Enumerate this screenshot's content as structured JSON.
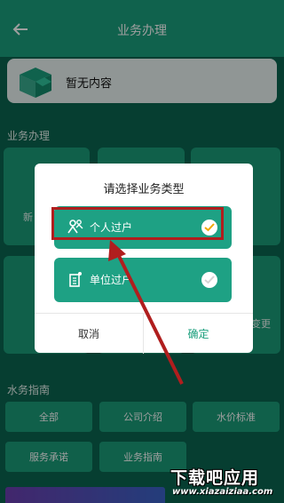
{
  "header": {
    "title": "业务办理"
  },
  "empty_card": {
    "text": "暂无内容"
  },
  "sections": {
    "business": "业务办理",
    "guide": "水务指南"
  },
  "background_tiles": {
    "left_partial": "新",
    "right_partial": "变更"
  },
  "guide_buttons": [
    "全部",
    "公司介绍",
    "水价标准",
    "服务承诺",
    "业务指南"
  ],
  "dialog": {
    "title": "请选择业务类型",
    "options": [
      {
        "label": "个人过户",
        "icon": "user-transfer-icon",
        "selected": true
      },
      {
        "label": "单位过户",
        "icon": "building-icon",
        "selected": false
      }
    ],
    "cancel": "取消",
    "confirm": "确定"
  },
  "watermark": {
    "main": "下载吧应用",
    "sub": "www.xiazaiziaa.com"
  },
  "colors": {
    "primary": "#1a9e7c",
    "dark_bg": "#0b6450",
    "annotation": "#b01e1e",
    "check": "#f0a800"
  }
}
